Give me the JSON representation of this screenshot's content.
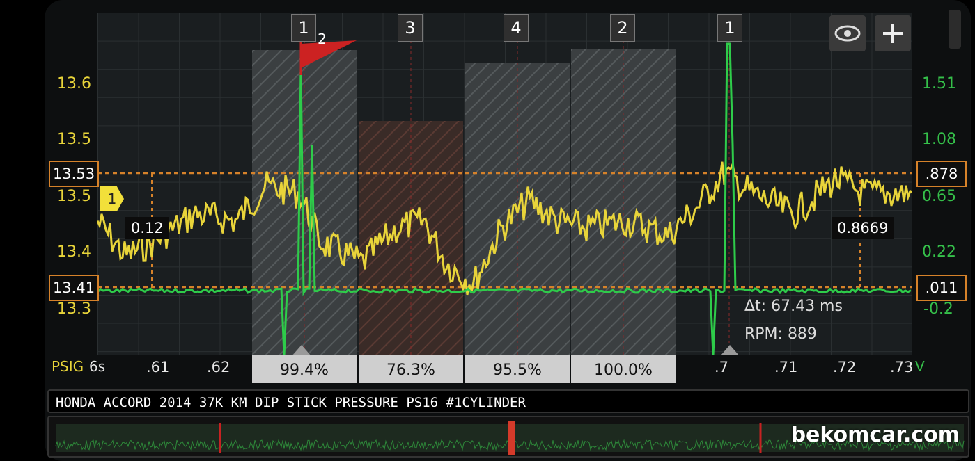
{
  "app": {
    "watermark": "bekomcar.com"
  },
  "toolbar": {
    "eye_icon": "eye-icon",
    "add_icon": "plus-icon"
  },
  "left_axis": {
    "unit": "PSIG",
    "color": "#e8d43a",
    "ticks": [
      "13.6",
      "13.5",
      "13.5",
      "13.4",
      "13.3"
    ]
  },
  "right_axis": {
    "unit": "V",
    "color": "#35c04a",
    "ticks": [
      "1.51",
      "1.08",
      "0.65",
      "0.22",
      "-0.2"
    ]
  },
  "x_axis": {
    "scale_label": "6s",
    "ticks": [
      ".61",
      ".62",
      ".7",
      ".71",
      ".72",
      ".73"
    ]
  },
  "cursors": {
    "left_upper": "13.53",
    "left_lower": "13.41",
    "right_upper": ".878",
    "right_lower": ".011",
    "left_delta": "0.12",
    "right_delta": "0.8669",
    "trace_marker": "1"
  },
  "cylinder_markers": [
    "1",
    "3",
    "4",
    "2",
    "1"
  ],
  "flag": {
    "label": "2",
    "color": "#cc2222"
  },
  "measurement": {
    "delta_t": "Δt: 67.43 ms",
    "rpm": "RPM: 889"
  },
  "segments": [
    "99.4%",
    "76.3%",
    "95.5%",
    "100.0%"
  ],
  "trace_title": "HONDA ACCORD 2014 37K KM DIP STICK PRESSURE PS16 #1CYLINDER",
  "colors": {
    "pressure_trace": "#e8d43a",
    "voltage_trace": "#2ecc4a",
    "cursor": "#d6822a"
  }
}
